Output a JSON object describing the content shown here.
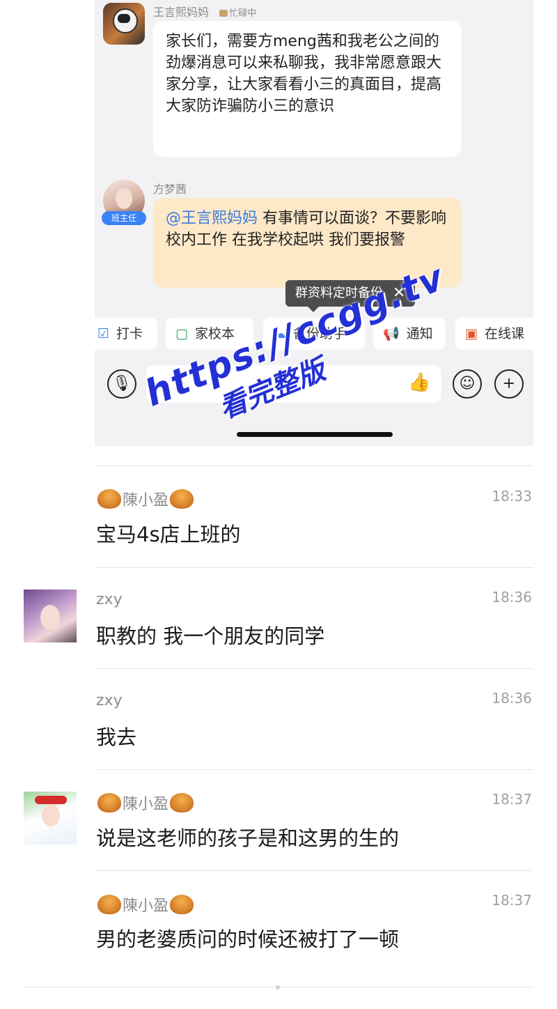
{
  "embedded_chat": {
    "messages": [
      {
        "sender": "王言熙妈妈",
        "status": "忙碌中",
        "text": "家长们，需要方meng茜和我老公之间的劲爆消息可以来私聊我，我非常愿意跟大家分享，让大家看看小三的真面目，提高大家防诈骗防小三的意识"
      },
      {
        "sender": "方梦茜",
        "badge": "班主任",
        "mention": "@王言熙妈妈",
        "text": " 有事情可以面谈？不要影响校内工作  在我学校起哄  我们要报警"
      }
    ],
    "tooltip": {
      "text": "群资料定时备份",
      "close": "✕"
    },
    "toolbar": [
      {
        "icon": "checkin-icon",
        "glyph": "☑",
        "label": "打卡",
        "color": "#3b82f6"
      },
      {
        "icon": "notebook-icon",
        "glyph": "▢",
        "label": "家校本",
        "color": "#22a35a"
      },
      {
        "icon": "cloud-backup-icon",
        "glyph": "☁",
        "label": "备份助手",
        "color": "#3b82f6"
      },
      {
        "icon": "megaphone-icon",
        "glyph": "📢",
        "label": "通知",
        "color": "#e0562c"
      },
      {
        "icon": "live-class-icon",
        "glyph": "▣",
        "label": "在线课",
        "color": "#e0562c"
      }
    ],
    "input": {
      "placeholder": "",
      "mic_glyph": "🎙",
      "like_glyph": "👍",
      "emoji_glyph": "☺",
      "plus_glyph": "+"
    }
  },
  "comments": [
    {
      "name": "陳小盈",
      "decorated": true,
      "time": "18:33",
      "text": "宝马4s店上班的"
    },
    {
      "name": "zxy",
      "decorated": false,
      "time": "18:36",
      "text": "职教的 我一个朋友的同学"
    },
    {
      "name": "zxy",
      "decorated": false,
      "time": "18:36",
      "text": "我去"
    },
    {
      "name": "陳小盈",
      "decorated": true,
      "time": "18:37",
      "text": "说是这老师的孩子是和这男的生的"
    },
    {
      "name": "陳小盈",
      "decorated": true,
      "time": "18:37",
      "text": "男的老婆质问的时候还被打了一顿"
    }
  ],
  "watermark": {
    "line1": "https://ccgg.tv",
    "line2": "看完整版"
  }
}
